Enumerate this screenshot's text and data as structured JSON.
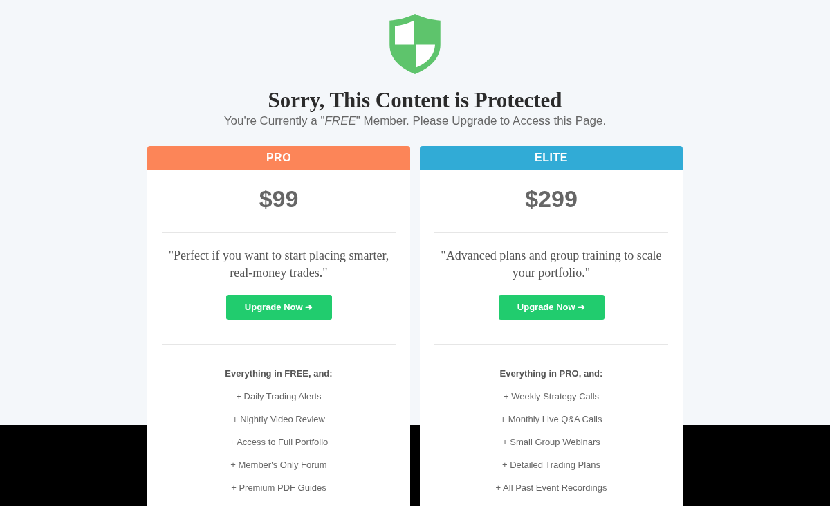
{
  "title": "Sorry, This Content is Protected",
  "subtitle": "You're Currently a \"*FREE*\" Member. Please Upgrade to Access this Page.",
  "plans": [
    {
      "name": "PRO",
      "color": "#fc8558",
      "price": "$99",
      "quote": "\"Perfect if you want to start placing smarter, real-money trades.\"",
      "button": "Upgrade Now ➜",
      "features_heading": "Everything in FREE, and:",
      "features": [
        "+ Daily Trading Alerts",
        "+ Nightly Video Review",
        "+ Access to Full Portfolio",
        "+ Member's Only Forum",
        "+ Premium PDF Guides"
      ]
    },
    {
      "name": "ELITE",
      "color": "#31abd6",
      "price": "$299",
      "quote": "\"Advanced plans and group training to scale your portfolio.\"",
      "button": "Upgrade Now ➜",
      "features_heading": "Everything in PRO, and:",
      "features": [
        "+ Weekly Strategy Calls",
        "+ Monthly Live Q&A Calls",
        "+ Small Group Webinars",
        "+ Detailed Trading Plans",
        "+ All Past Event Recordings"
      ]
    }
  ]
}
